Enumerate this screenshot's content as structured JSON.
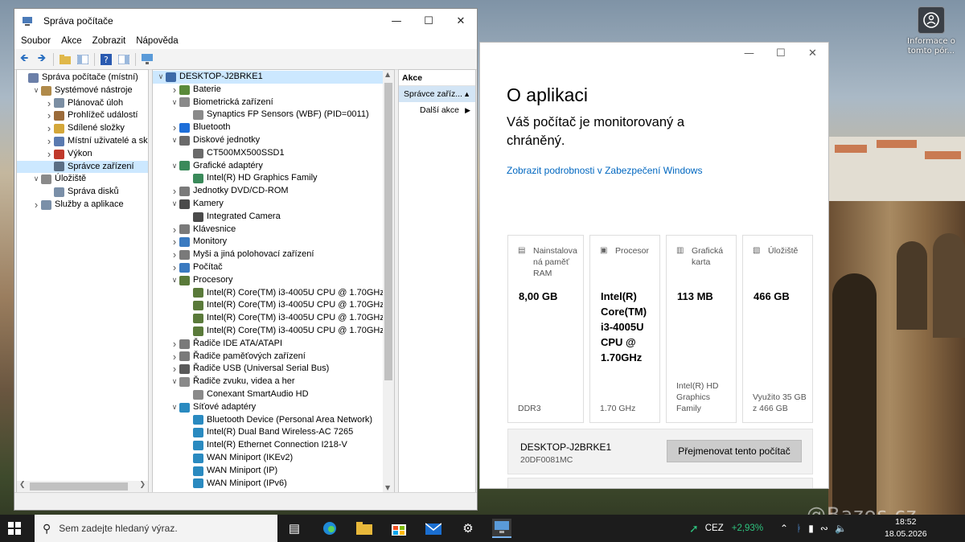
{
  "desktop": {
    "info_icon_label_1": "Informace o",
    "info_icon_label_2": "tomto pór...",
    "watermark": "@Bazos.cz"
  },
  "computer_management": {
    "title": "Správa počítače",
    "menu": [
      "Soubor",
      "Akce",
      "Zobrazit",
      "Nápověda"
    ],
    "left_tree": [
      {
        "label": "Správa počítače (místní)",
        "indent": 0,
        "expander": "",
        "icon_color": "#6b7fa8"
      },
      {
        "label": "Systémové nástroje",
        "indent": 1,
        "expander": "v",
        "icon_color": "#b08a4a"
      },
      {
        "label": "Plánovač úloh",
        "indent": 2,
        "expander": ">",
        "icon_color": "#7b8ea3"
      },
      {
        "label": "Prohlížeč událostí",
        "indent": 2,
        "expander": ">",
        "icon_color": "#9b6b3a"
      },
      {
        "label": "Sdílené složky",
        "indent": 2,
        "expander": ">",
        "icon_color": "#d4a73a"
      },
      {
        "label": "Místní uživatelé a skupiny",
        "indent": 2,
        "expander": ">",
        "icon_color": "#5a7ab0"
      },
      {
        "label": "Výkon",
        "indent": 2,
        "expander": ">",
        "icon_color": "#c0392b"
      },
      {
        "label": "Správce zařízení",
        "indent": 2,
        "expander": "",
        "icon_color": "#5a6e84",
        "selected": true
      },
      {
        "label": "Úložiště",
        "indent": 1,
        "expander": "v",
        "icon_color": "#8a8a8a"
      },
      {
        "label": "Správa disků",
        "indent": 2,
        "expander": "",
        "icon_color": "#7a8fa8"
      },
      {
        "label": "Služby a aplikace",
        "indent": 1,
        "expander": ">",
        "icon_color": "#7a8fa8"
      }
    ],
    "device_tree": [
      {
        "label": "DESKTOP-J2BRKE1",
        "indent": 0,
        "expander": "v",
        "icon_color": "#3d6aa8",
        "selected": true
      },
      {
        "label": "Baterie",
        "indent": 1,
        "expander": ">",
        "icon_color": "#5a8a3a"
      },
      {
        "label": "Biometrická zařízení",
        "indent": 1,
        "expander": "v",
        "icon_color": "#8a8a8a"
      },
      {
        "label": "Synaptics FP Sensors (WBF) (PID=0011)",
        "indent": 2,
        "expander": "",
        "icon_color": "#8a8a8a"
      },
      {
        "label": "Bluetooth",
        "indent": 1,
        "expander": ">",
        "icon_color": "#1e6fd9"
      },
      {
        "label": "Diskové jednotky",
        "indent": 1,
        "expander": "v",
        "icon_color": "#6a6a6a"
      },
      {
        "label": "CT500MX500SSD1",
        "indent": 2,
        "expander": "",
        "icon_color": "#6a6a6a"
      },
      {
        "label": "Grafické adaptéry",
        "indent": 1,
        "expander": "v",
        "icon_color": "#3a8a5a"
      },
      {
        "label": "Intel(R) HD Graphics Family",
        "indent": 2,
        "expander": "",
        "icon_color": "#3a8a5a"
      },
      {
        "label": "Jednotky DVD/CD-ROM",
        "indent": 1,
        "expander": ">",
        "icon_color": "#7a7a7a"
      },
      {
        "label": "Kamery",
        "indent": 1,
        "expander": "v",
        "icon_color": "#4a4a4a"
      },
      {
        "label": "Integrated Camera",
        "indent": 2,
        "expander": "",
        "icon_color": "#4a4a4a"
      },
      {
        "label": "Klávesnice",
        "indent": 1,
        "expander": ">",
        "icon_color": "#7a7a7a"
      },
      {
        "label": "Monitory",
        "indent": 1,
        "expander": ">",
        "icon_color": "#3a7ac0"
      },
      {
        "label": "Myši a jiná polohovací zařízení",
        "indent": 1,
        "expander": ">",
        "icon_color": "#7a7a7a"
      },
      {
        "label": "Počítač",
        "indent": 1,
        "expander": ">",
        "icon_color": "#3a7ac0"
      },
      {
        "label": "Procesory",
        "indent": 1,
        "expander": "v",
        "icon_color": "#5a7a3a"
      },
      {
        "label": "Intel(R) Core(TM) i3-4005U CPU @ 1.70GHz",
        "indent": 2,
        "expander": "",
        "icon_color": "#5a7a3a"
      },
      {
        "label": "Intel(R) Core(TM) i3-4005U CPU @ 1.70GHz",
        "indent": 2,
        "expander": "",
        "icon_color": "#5a7a3a"
      },
      {
        "label": "Intel(R) Core(TM) i3-4005U CPU @ 1.70GHz",
        "indent": 2,
        "expander": "",
        "icon_color": "#5a7a3a"
      },
      {
        "label": "Intel(R) Core(TM) i3-4005U CPU @ 1.70GHz",
        "indent": 2,
        "expander": "",
        "icon_color": "#5a7a3a"
      },
      {
        "label": "Řadiče IDE ATA/ATAPI",
        "indent": 1,
        "expander": ">",
        "icon_color": "#7a7a7a"
      },
      {
        "label": "Řadiče paměťových zařízení",
        "indent": 1,
        "expander": ">",
        "icon_color": "#7a7a7a"
      },
      {
        "label": "Řadiče USB (Universal Serial Bus)",
        "indent": 1,
        "expander": ">",
        "icon_color": "#5a5a5a"
      },
      {
        "label": "Řadiče zvuku, videa a her",
        "indent": 1,
        "expander": "v",
        "icon_color": "#8a8a8a"
      },
      {
        "label": "Conexant SmartAudio HD",
        "indent": 2,
        "expander": "",
        "icon_color": "#8a8a8a"
      },
      {
        "label": "Síťové adaptéry",
        "indent": 1,
        "expander": "v",
        "icon_color": "#2a8ac0"
      },
      {
        "label": "Bluetooth Device (Personal Area Network)",
        "indent": 2,
        "expander": "",
        "icon_color": "#2a8ac0"
      },
      {
        "label": "Intel(R) Dual Band Wireless-AC 7265",
        "indent": 2,
        "expander": "",
        "icon_color": "#2a8ac0"
      },
      {
        "label": "Intel(R) Ethernet Connection I218-V",
        "indent": 2,
        "expander": "",
        "icon_color": "#2a8ac0"
      },
      {
        "label": "WAN Miniport (IKEv2)",
        "indent": 2,
        "expander": "",
        "icon_color": "#2a8ac0"
      },
      {
        "label": "WAN Miniport (IP)",
        "indent": 2,
        "expander": "",
        "icon_color": "#2a8ac0"
      },
      {
        "label": "WAN Miniport (IPv6)",
        "indent": 2,
        "expander": "",
        "icon_color": "#2a8ac0"
      }
    ],
    "actions": {
      "header": "Akce",
      "selected": "Správce zaříz...",
      "more": "Další akce"
    }
  },
  "about": {
    "title": "O aplikaci",
    "status": "Váš počítač je monitorovaný a chráněný.",
    "link": "Zobrazit podrobnosti v Zabezpečení Windows",
    "cards": [
      {
        "label": "Nainstalovaná paměť RAM",
        "label_lines": [
          "Nainstalova",
          "ná paměť",
          "RAM"
        ],
        "value_lines": [
          "8,00 GB"
        ],
        "foot_lines": [
          "DDR3"
        ]
      },
      {
        "label": "Procesor",
        "label_lines": [
          "Procesor"
        ],
        "value_lines": [
          "Intel(R)",
          "Core(TM)",
          "i3-4005U",
          "CPU @",
          "1.70GHz"
        ],
        "foot_lines": [
          "1.70 GHz"
        ]
      },
      {
        "label": "Grafická karta",
        "label_lines": [
          "Grafická",
          "karta"
        ],
        "value_lines": [
          "113 MB"
        ],
        "foot_lines": [
          "Intel(R) HD",
          "Graphics",
          "Family"
        ]
      },
      {
        "label": "Úložiště",
        "label_lines": [
          "Úložiště"
        ],
        "value_lines": [
          "466 GB"
        ],
        "foot_lines": [
          "Využito 35 GB",
          "z 466 GB"
        ]
      }
    ],
    "device_name": "DESKTOP-J2BRKE1",
    "model": "20DF0081MC",
    "rename_button": "Přejmenovat tento počítač"
  },
  "taskbar": {
    "search_placeholder": "Sem zadejte hledaný výraz.",
    "stock_name": "CEZ",
    "stock_change": "+2,93%",
    "time": "18:52",
    "date": "18.05.2026",
    "accent": "#2ec27e"
  }
}
